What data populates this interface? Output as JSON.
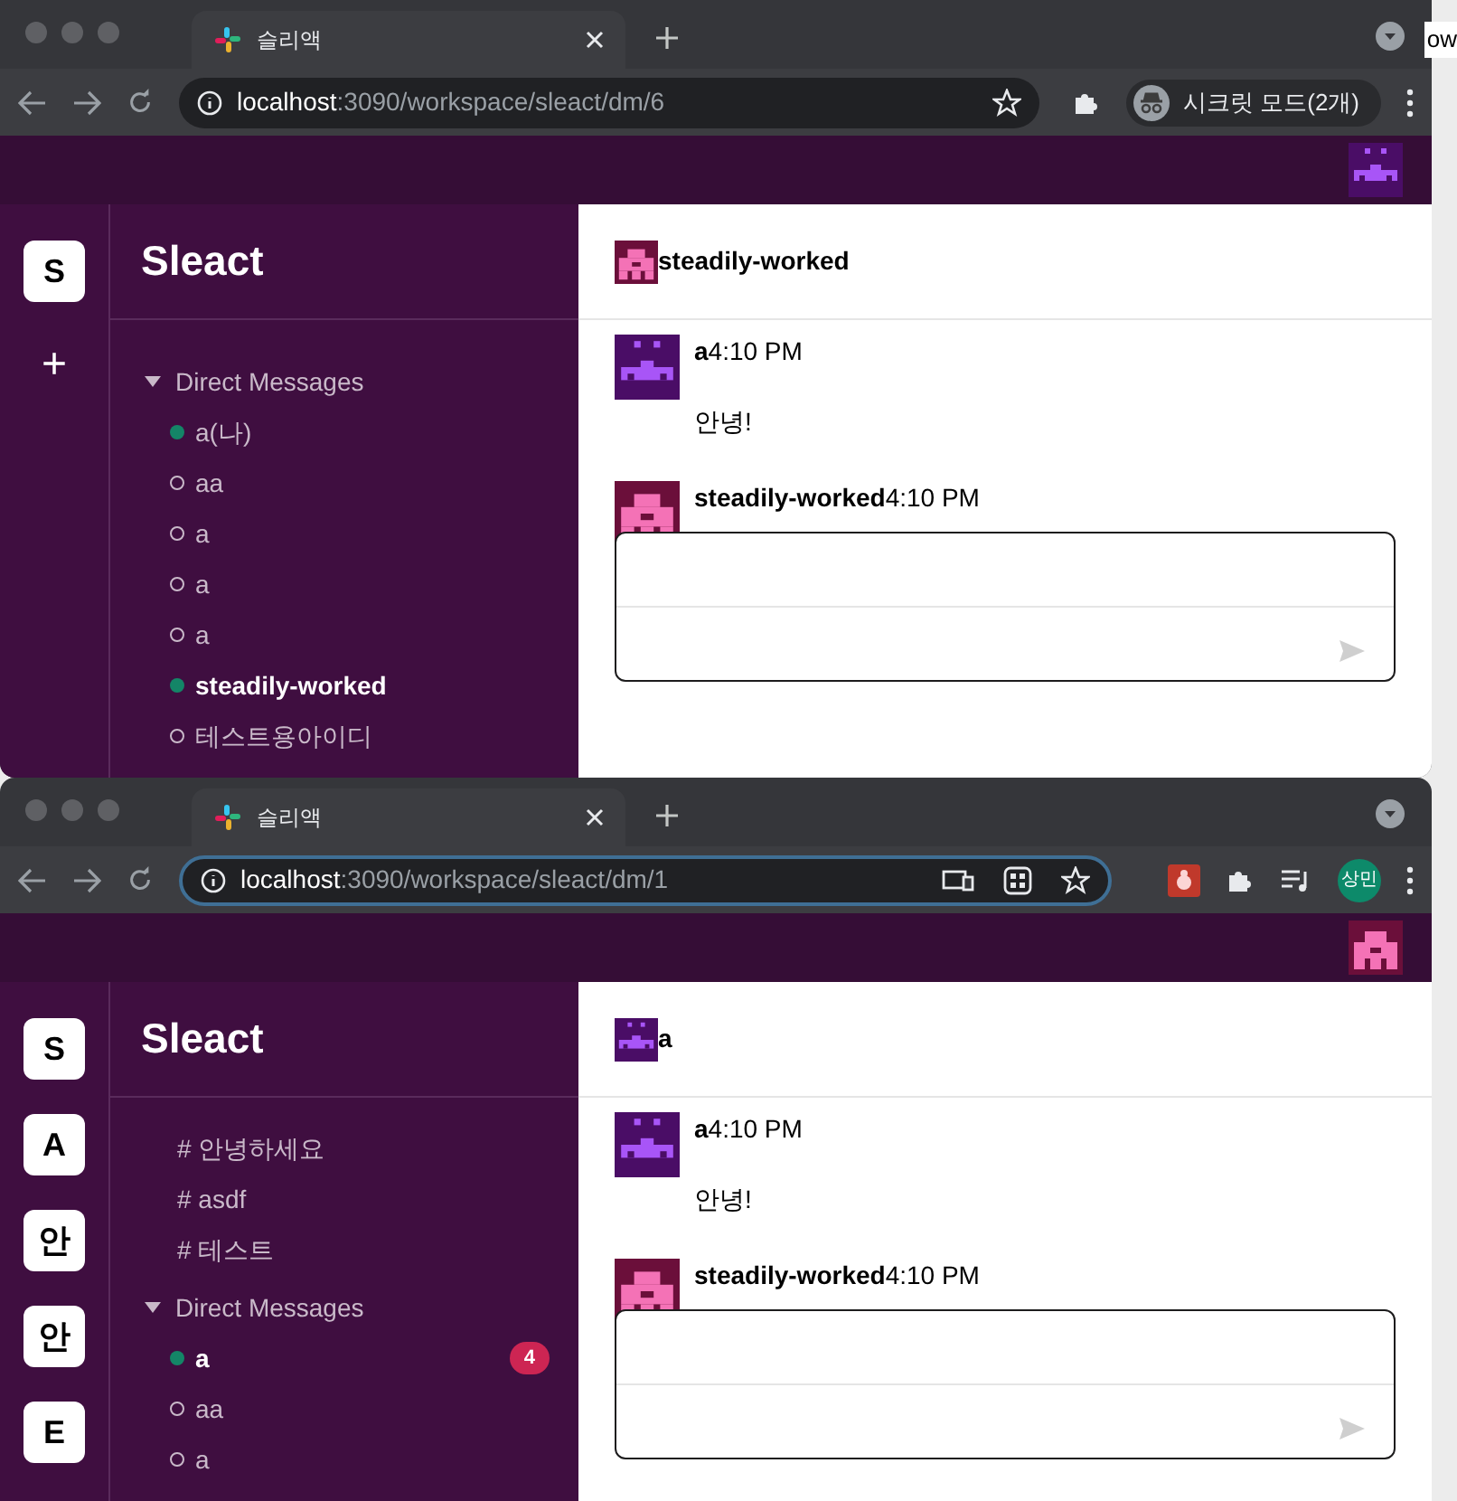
{
  "windows": [
    {
      "tab": {
        "title": "슬리액"
      },
      "address": {
        "host": "localhost",
        "path": ":3090/workspace/sleact/dm/6"
      },
      "toolbar_items": [
        {
          "kind": "extensions"
        },
        {
          "kind": "incognito",
          "label": "시크릿 모드(2개)"
        }
      ],
      "header_avatar": {
        "kind": "robot"
      },
      "workspaces": [
        {
          "kind": "workspace",
          "label": "S"
        },
        {
          "kind": "add",
          "label": "+"
        }
      ],
      "workspace_title": "Sleact",
      "dm_section": {
        "title": "Direct Messages",
        "expanded": true
      },
      "dms": [
        {
          "name": "a(나)",
          "online": true,
          "selected": false
        },
        {
          "name": "aa",
          "online": false,
          "selected": false
        },
        {
          "name": "a",
          "online": false,
          "selected": false
        },
        {
          "name": "a",
          "online": false,
          "selected": false
        },
        {
          "name": "a",
          "online": false,
          "selected": false
        },
        {
          "name": "steadily-worked",
          "online": true,
          "selected": true
        },
        {
          "name": "테스트용아이디",
          "online": false,
          "selected": false
        }
      ],
      "chat": {
        "name": "steadily-worked",
        "avatar": {
          "kind": "blob"
        },
        "messages": [
          {
            "user": "a",
            "time": "4:10 PM",
            "text": "안녕!",
            "avatar": {
              "kind": "robot"
            }
          },
          {
            "user": "steadily-worked",
            "time": "4:10 PM",
            "avatar": {
              "kind": "blob"
            }
          }
        ]
      }
    },
    {
      "tab": {
        "title": "슬리액"
      },
      "address": {
        "host": "localhost",
        "path": ":3090/workspace/sleact/dm/1"
      },
      "address_icons": [
        {
          "kind": "cast"
        },
        {
          "kind": "qr"
        }
      ],
      "toolbar_items": [
        {
          "kind": "bug"
        },
        {
          "kind": "extensions"
        },
        {
          "kind": "media"
        },
        {
          "kind": "profile",
          "label": "상민"
        }
      ],
      "header_avatar": {
        "kind": "blob"
      },
      "workspaces": [
        {
          "kind": "workspace",
          "label": "S"
        },
        {
          "kind": "workspace",
          "label": "A"
        },
        {
          "kind": "workspace",
          "label": "안"
        },
        {
          "kind": "workspace",
          "label": "안"
        },
        {
          "kind": "workspace",
          "label": "E"
        }
      ],
      "workspace_title": "Sleact",
      "channels": [
        "# 안녕하세요",
        "# asdf",
        "# 테스트"
      ],
      "dm_section": {
        "title": "Direct Messages",
        "expanded": true
      },
      "dms": [
        {
          "name": "a",
          "online": true,
          "selected": true,
          "badge": "4"
        },
        {
          "name": "aa",
          "online": false,
          "selected": false
        },
        {
          "name": "a",
          "online": false,
          "selected": false
        }
      ],
      "chat": {
        "name": "a",
        "avatar": {
          "kind": "robot"
        },
        "messages": [
          {
            "user": "a",
            "time": "4:10 PM",
            "text": "안녕!",
            "avatar": {
              "kind": "robot"
            }
          },
          {
            "user": "steadily-worked",
            "time": "4:10 PM",
            "avatar": {
              "kind": "blob"
            }
          }
        ]
      }
    }
  ],
  "background_text": "ow"
}
